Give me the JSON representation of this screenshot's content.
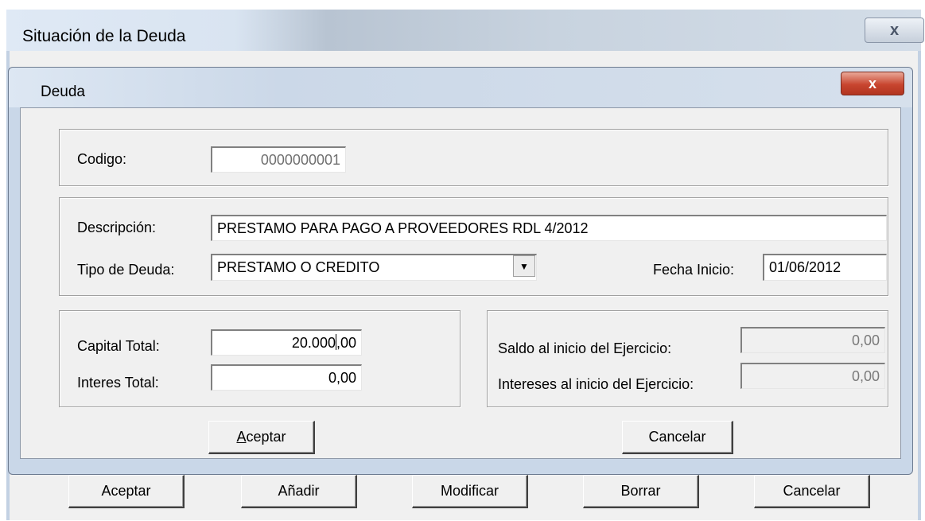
{
  "outer_window": {
    "title": "Situación de la Deuda",
    "close_glyph": "x",
    "buttons": [
      "Aceptar",
      "Añadir",
      "Modificar",
      "Borrar",
      "Cancelar"
    ]
  },
  "dialog": {
    "title": "Deuda",
    "close_glyph": "x",
    "codigo_label": "Codigo:",
    "codigo_value": "0000000001",
    "descripcion_label": "Descripción:",
    "descripcion_value": "PRESTAMO PARA PAGO A PROVEEDORES RDL 4/2012",
    "tipo_label": "Tipo de Deuda:",
    "tipo_value": "PRESTAMO O CREDITO",
    "fecha_label": "Fecha Inicio:",
    "fecha_value": "01/06/2012",
    "capital_label": "Capital Total:",
    "capital_value_a": "20.000",
    "capital_value_b": ",00",
    "interes_label": "Interes Total:",
    "interes_value": "0,00",
    "saldo_label": "Saldo al inicio del Ejercicio:",
    "saldo_value": "0,00",
    "intereses_label": "Intereses al inicio del Ejercicio:",
    "intereses_value": "0,00",
    "aceptar_accel": "A",
    "aceptar_rest": "ceptar",
    "cancelar_label": "Cancelar"
  },
  "icons": {
    "dropdown": "chevron-down-icon",
    "close": "close-icon"
  }
}
